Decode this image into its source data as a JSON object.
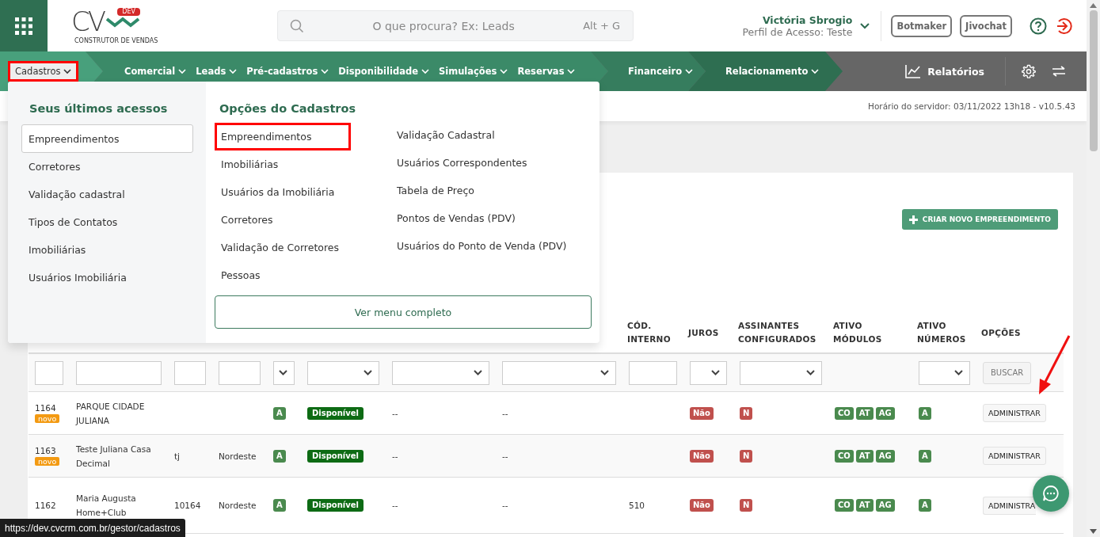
{
  "header": {
    "logo": {
      "mark": "CV",
      "tag": "DEV",
      "subtitle": "CONSTRUTOR DE VENDAS"
    },
    "search": {
      "placeholder": "O que procura? Ex: Leads",
      "shortcut": "Alt + G"
    },
    "user": {
      "name": "Victória Sbrogio",
      "profile": "Perfil de Acesso: Teste"
    },
    "buttons": [
      "Botmaker",
      "Jivochat"
    ]
  },
  "nav": {
    "segments": [
      {
        "items": [
          {
            "label": "Cadastros",
            "highlighted": true
          }
        ]
      },
      {
        "items": [
          {
            "label": "Comercial",
            "highlighted": false
          },
          {
            "label": "Leads",
            "highlighted": false
          },
          {
            "label": "Pré-cadastros",
            "highlighted": false
          },
          {
            "label": "Disponibilidade",
            "highlighted": false
          },
          {
            "label": "Simulações",
            "highlighted": false
          },
          {
            "label": "Reservas",
            "highlighted": false
          }
        ]
      },
      {
        "items": [
          {
            "label": "Financeiro",
            "highlighted": false
          }
        ]
      },
      {
        "items": [
          {
            "label": "Relacionamento",
            "highlighted": false
          }
        ]
      }
    ],
    "reports": "Relatórios"
  },
  "server_info": "Horário do servidor: 03/11/2022 13h18 - v10.5.43",
  "create_button": "CRIAR NOVO EMPREENDIMENTO",
  "table": {
    "columns": [
      {
        "kind": "text"
      },
      {
        "kind": "text"
      },
      {
        "kind": "text"
      },
      {
        "kind": "text"
      },
      {
        "kind": "select"
      },
      {
        "kind": "select"
      },
      {
        "kind": "select"
      },
      {
        "kind": "select"
      },
      {
        "label": "CÓD. INTERNO",
        "kind": "text"
      },
      {
        "label": "JUROS",
        "kind": "select"
      },
      {
        "label": "ASSINANTES CONFIGURADOS",
        "kind": "select"
      },
      {
        "label": "ATIVO MÓDULOS",
        "kind": "none"
      },
      {
        "label": "ATIVO NÚMEROS",
        "kind": "select"
      },
      {
        "label": "OPÇÕES",
        "kind": "button",
        "button": "BUSCAR"
      }
    ],
    "rows": [
      {
        "id": "1164",
        "badge": "novo",
        "name": "PARQUE CIDADE JULIANA",
        "column_5": "A",
        "status": "Disponível",
        "column_7": "--",
        "column_8": "--",
        "interest": "Não",
        "signers": "N",
        "modules": [
          "CO",
          "AT",
          "AG"
        ],
        "numbers": "A",
        "action": "ADMINISTRAR"
      },
      {
        "id": "1163",
        "badge": "novo",
        "name": "Teste Juliana Casa Decimal",
        "column_3": "tj",
        "column_4": "Nordeste",
        "column_5": "A",
        "status": "Disponível",
        "column_7": "--",
        "column_8": "--",
        "interest": "Não",
        "signers": "N",
        "modules": [
          "CO",
          "AT",
          "AG"
        ],
        "numbers": "A",
        "action": "ADMINISTRAR"
      },
      {
        "id": "1162",
        "name": "Maria Augusta Home+Club",
        "column_3": "10164",
        "column_4": "Nordeste",
        "column_5": "A",
        "status": "Disponível",
        "column_7": "--",
        "column_8": "--",
        "internal_code": "510",
        "interest": "Não",
        "signers": "N",
        "modules": [
          "CO",
          "AT",
          "AG"
        ],
        "numbers": "A",
        "action": "ADMINISTRA"
      }
    ]
  },
  "menu": {
    "recent_title": "Seus últimos acessos",
    "recent": [
      {
        "label": "Empreendimentos",
        "selected": true
      },
      {
        "label": "Corretores",
        "selected": false
      },
      {
        "label": "Validação cadastral",
        "selected": false
      },
      {
        "label": "Tipos de Contatos",
        "selected": false
      },
      {
        "label": "Imobiliárias",
        "selected": false
      },
      {
        "label": "Usuários Imobiliária",
        "selected": false
      }
    ],
    "options_title": "Opções do Cadastros",
    "options": [
      [
        {
          "label": "Empreendimentos",
          "highlighted": true
        },
        {
          "label": "Imobiliárias",
          "highlighted": false
        },
        {
          "label": "Usuários da Imobiliária",
          "highlighted": false
        },
        {
          "label": "Corretores",
          "highlighted": false
        },
        {
          "label": "Validação de Corretores",
          "highlighted": false
        },
        {
          "label": "Pessoas",
          "highlighted": false
        }
      ],
      [
        {
          "label": "Validação Cadastral",
          "highlighted": false
        },
        {
          "label": "Usuários Correspondentes",
          "highlighted": false
        },
        {
          "label": "Tabela de Preço",
          "highlighted": false
        },
        {
          "label": "Pontos de Vendas (PDV)",
          "highlighted": false
        },
        {
          "label": "Usuários do Ponto de Venda (PDV)",
          "highlighted": false
        }
      ]
    ],
    "full_menu": "Ver menu completo"
  },
  "status_url": "https://dev.cvcrm.com.br/gestor/cadastros"
}
